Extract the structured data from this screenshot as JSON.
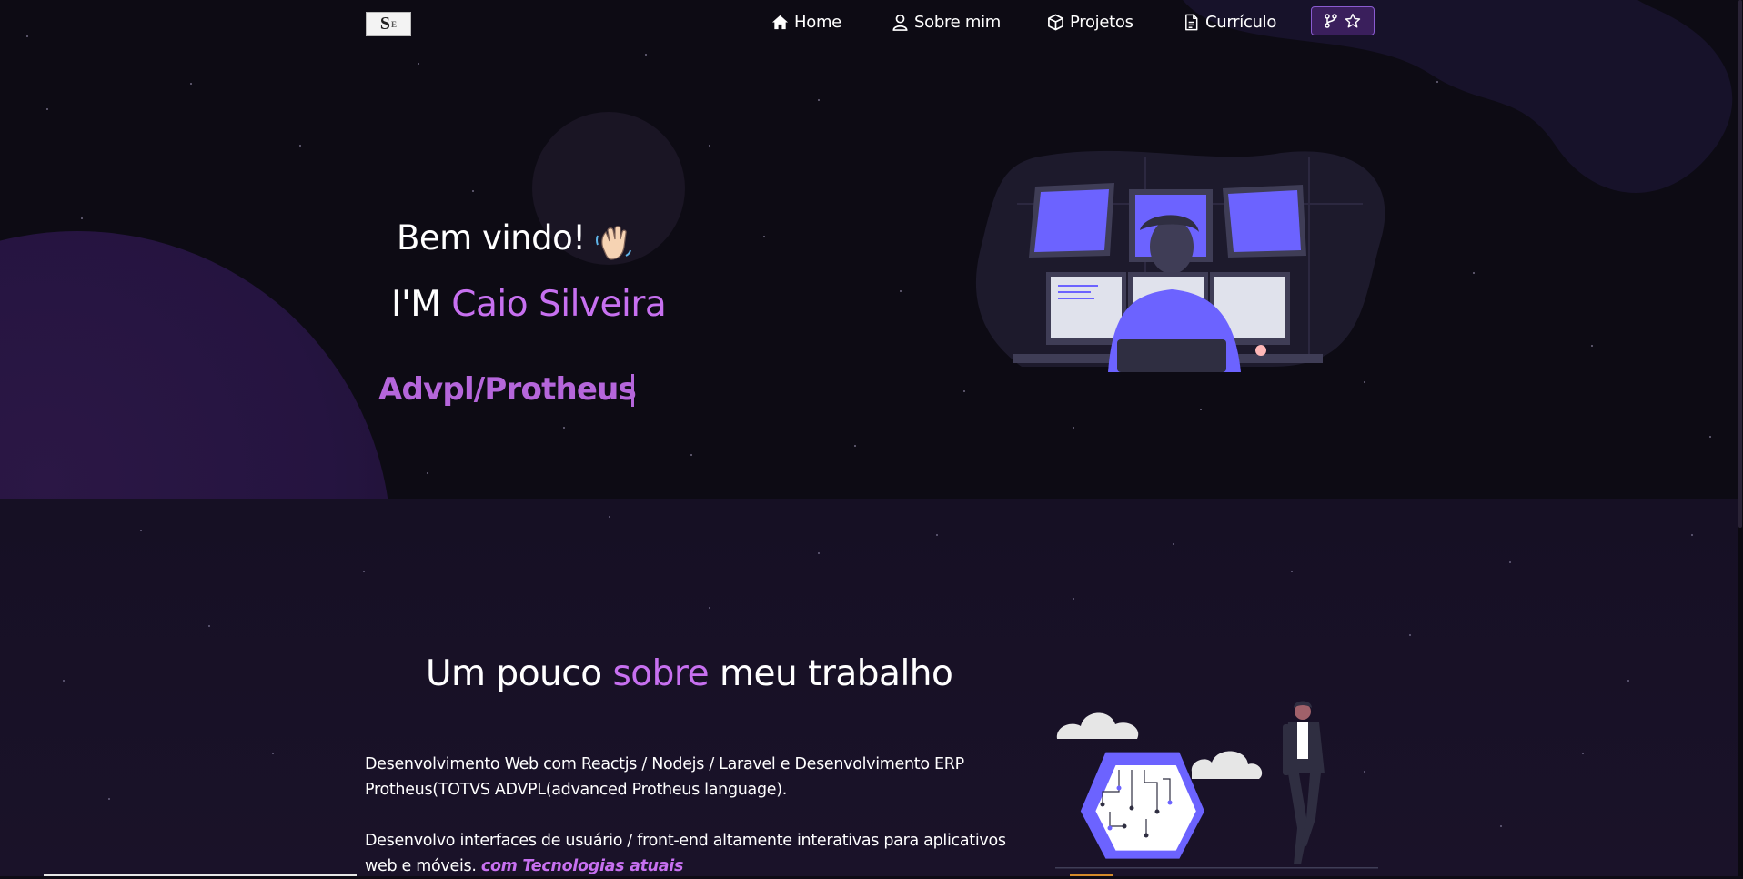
{
  "logo": {
    "text": "S",
    "sub": "E"
  },
  "nav": {
    "items": [
      {
        "label": "Home",
        "icon": "home-icon"
      },
      {
        "label": "Sobre mim",
        "icon": "user-icon"
      },
      {
        "label": "Projetos",
        "icon": "cube-icon"
      },
      {
        "label": "Currículo",
        "icon": "document-icon"
      }
    ],
    "github_icons": [
      "git-fork-icon",
      "star-icon"
    ]
  },
  "hero": {
    "greeting": "Bem vindo!",
    "greeting_emoji": "waving-hand-icon",
    "im_prefix": "I'M ",
    "name": "Caio Silveira",
    "typed_text": "Advpl/Protheus"
  },
  "about": {
    "title_before": "Um pouco ",
    "title_highlight": "sobre",
    "title_after": " meu trabalho",
    "paragraph1": "Desenvolvimento Web com Reactjs / Nodejs / Laravel e Desenvolvimento ERP Protheus(TOTVS ADVPL(advanced Protheus language).",
    "paragraph2": "Desenvolvo interfaces de usuário / front-end altamente interativas para aplicativos web e móveis.",
    "paragraph2_highlight": "com Tecnologias atuais"
  },
  "colors": {
    "accent": "#c770f0",
    "typed": "#b566db",
    "background": "#0d0b14",
    "about_bg": "#161024",
    "illustration": "#6c63ff"
  }
}
